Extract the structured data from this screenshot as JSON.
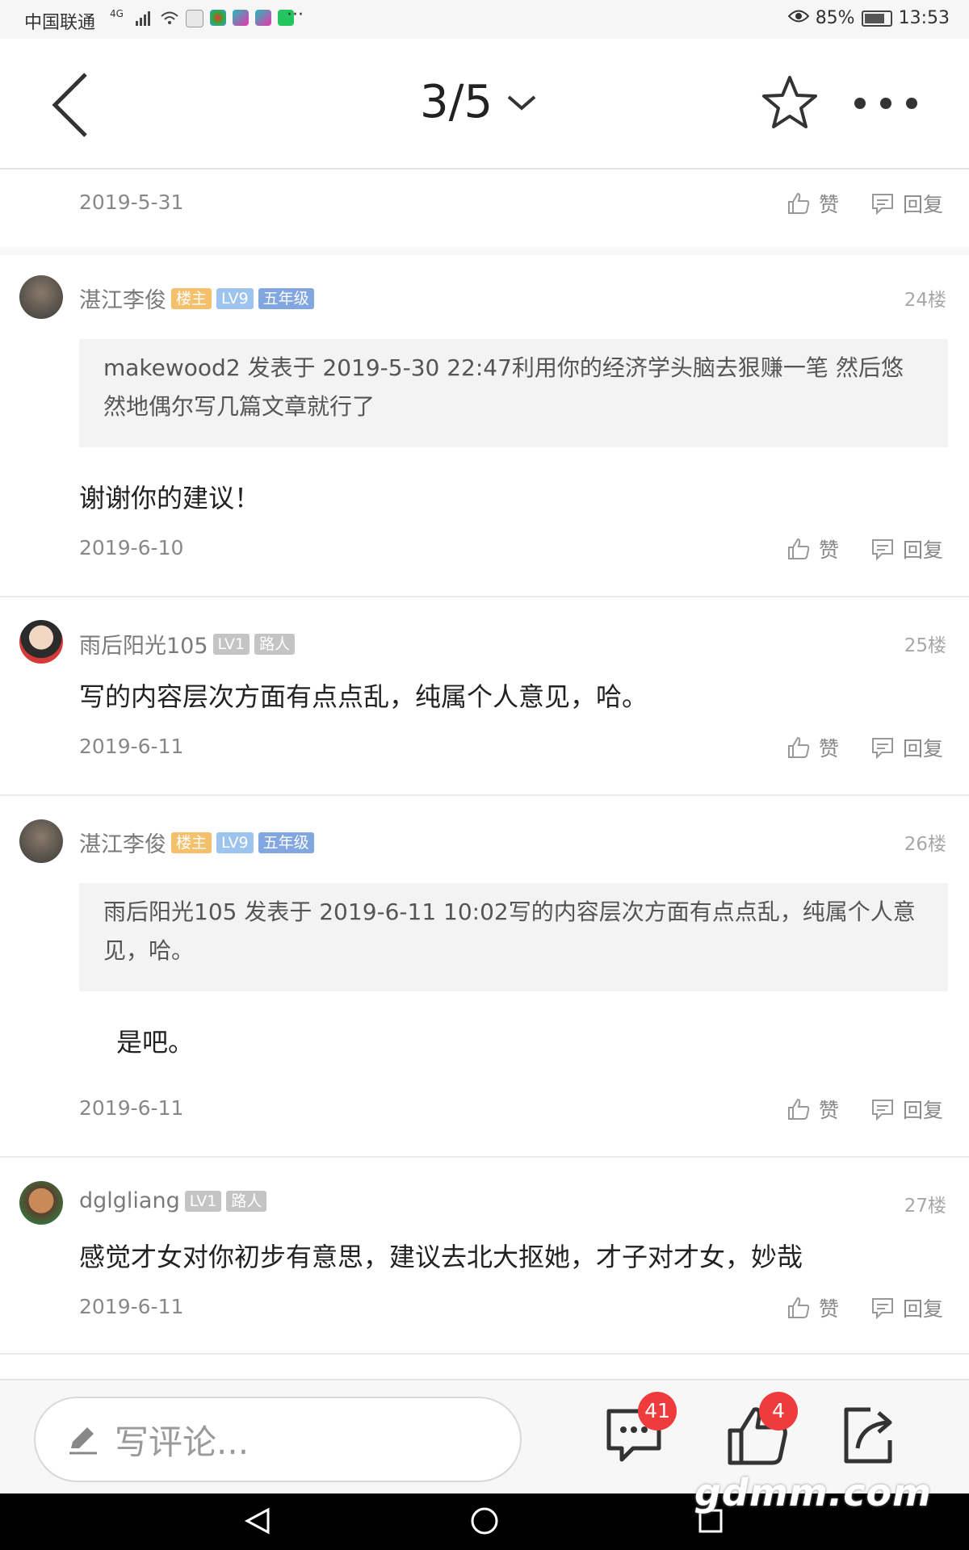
{
  "status_bar": {
    "carrier": "中国联通",
    "network": "4G",
    "battery": "85%",
    "time": "13:53"
  },
  "header": {
    "page_indicator": "3/5"
  },
  "posts": [
    {
      "date": "2019-5-31",
      "like_label": "赞",
      "reply_label": "回复"
    },
    {
      "username": "湛江李俊",
      "badges": [
        "楼主",
        "LV9",
        "五年级"
      ],
      "floor": "24楼",
      "quote": "makewood2 发表于 2019-5-30 22:47利用你的经济学头脑去狠赚一笔 然后悠然地偶尔写几篇文章就行了",
      "text": "谢谢你的建议！",
      "date": "2019-6-10",
      "like_label": "赞",
      "reply_label": "回复"
    },
    {
      "username": "雨后阳光105",
      "badges": [
        "LV1",
        "路人"
      ],
      "floor": "25楼",
      "text": "写的内容层次方面有点点乱，纯属个人意见，哈。",
      "date": "2019-6-11",
      "like_label": "赞",
      "reply_label": "回复"
    },
    {
      "username": "湛江李俊",
      "badges": [
        "楼主",
        "LV9",
        "五年级"
      ],
      "floor": "26楼",
      "quote": "雨后阳光105 发表于 2019-6-11 10:02写的内容层次方面有点点乱，纯属个人意见，哈。",
      "text": "是吧。",
      "date": "2019-6-11",
      "like_label": "赞",
      "reply_label": "回复"
    },
    {
      "username": "dglgliang",
      "badges": [
        "LV1",
        "路人"
      ],
      "floor": "27楼",
      "text": "感觉才女对你初步有意思，建议去北大抠她，才子对才女，妙哉",
      "date": "2019-6-11",
      "like_label": "赞",
      "reply_label": "回复"
    }
  ],
  "bottom_bar": {
    "comment_placeholder": "写评论...",
    "comment_count": "41",
    "like_count": "4"
  },
  "watermark": "gdmm.com",
  "colors": {
    "badge_host": "#f4c06c",
    "badge_level": "#9cc4ee",
    "badge_grade": "#82a6e0",
    "badge_gray": "#c4c4c4",
    "count_badge": "#ee3b3b"
  }
}
